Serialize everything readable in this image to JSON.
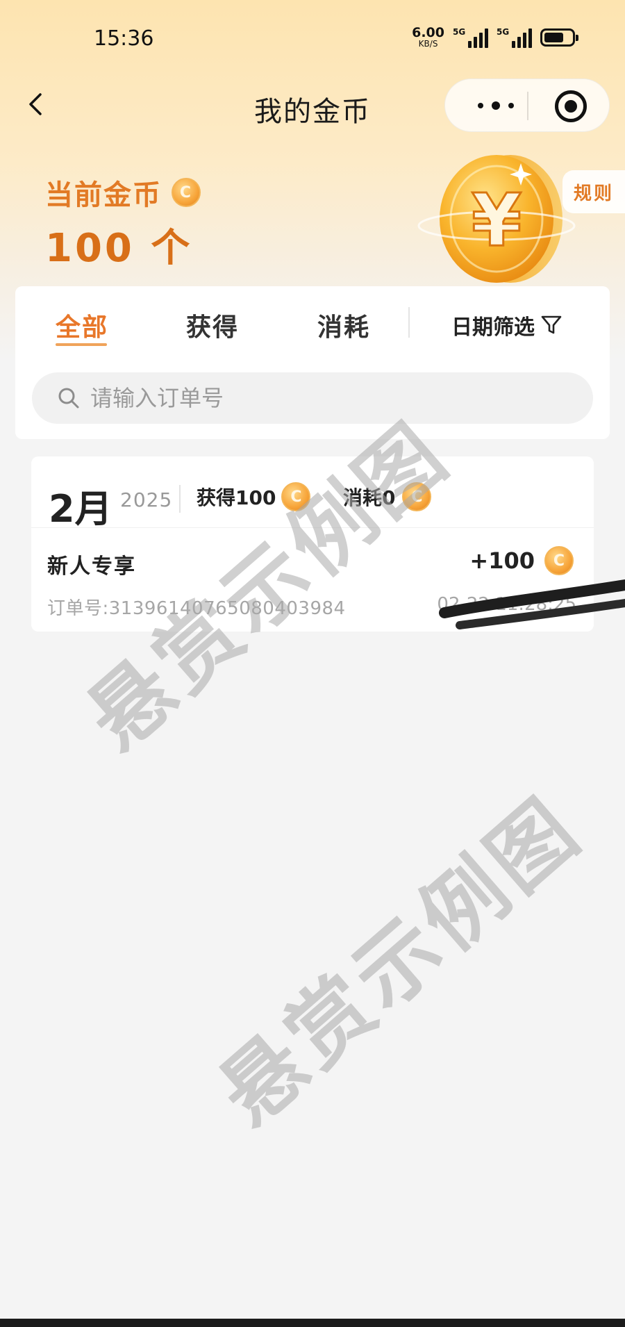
{
  "status_bar": {
    "time": "15:36",
    "net_speed_value": "6.00",
    "net_speed_unit": "KB/S",
    "signal_1_tag": "5G",
    "signal_2_tag": "5G"
  },
  "nav": {
    "title": "我的金币",
    "back_icon": "chevron-left-icon",
    "more_icon": "more-dots-icon",
    "close_icon": "target-icon"
  },
  "balance": {
    "label": "当前金币",
    "value": "100 个",
    "rules_label": "规则",
    "coin_symbol": "¥"
  },
  "filter": {
    "tabs": [
      {
        "label": "全部",
        "active": true
      },
      {
        "label": "获得",
        "active": false
      },
      {
        "label": "消耗",
        "active": false
      }
    ],
    "date_filter_label": "日期筛选",
    "search_placeholder": "请输入订单号"
  },
  "month_group": {
    "month": "2月",
    "year": "2025",
    "earned_label": "获得100",
    "spent_label": "消耗0",
    "records": [
      {
        "title": "新人专享",
        "amount": "+100",
        "order": "订单号:3139614076508040398​4",
        "time": "02-22 11:28:25"
      }
    ]
  },
  "watermark": "悬赏示例图",
  "colors": {
    "accent": "#e8772a",
    "balance": "#d86f18",
    "header_top": "#fde4b0",
    "background": "#f4f4f4"
  }
}
